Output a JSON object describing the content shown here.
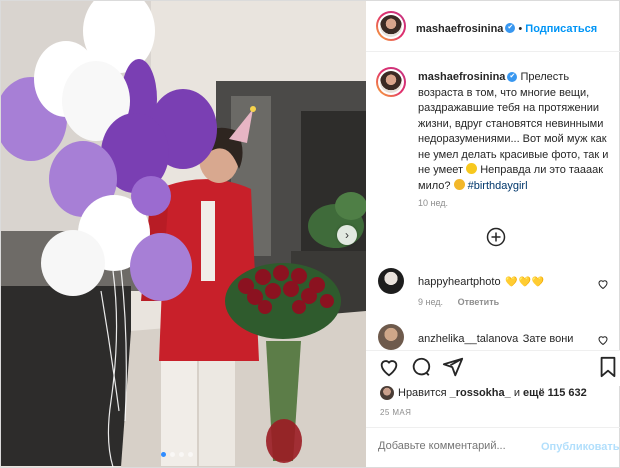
{
  "header": {
    "username": "mashaefrosinina",
    "verified_icon": "✔",
    "separator": "•",
    "follow_label": "Подписаться"
  },
  "caption": {
    "username": "mashaefrosinina",
    "verified_icon": "✔",
    "text": "Прелесть возраста в том, что многие вещи, раздражавшие тебя на протяжении жизни, вдруг становятся невинными недоразумениями... Вот мой муж как не умел делать красивые фото, так и не умеет",
    "text2": "Неправда ли это таааак мило?",
    "hashtag": "#birthdaygirl",
    "time_ago": "10 нед."
  },
  "load_more_icon": "plus-circle",
  "comments": [
    {
      "username": "happyheartphoto",
      "text": "",
      "emoji": "💛💛💛",
      "time": "9 нед.",
      "reply": "Ответить"
    },
    {
      "username": "anzhelika__talanova",
      "text": "Зате вони"
    }
  ],
  "likes": {
    "prefix": "Нравится",
    "user": "_rossokha_",
    "middle": "и",
    "count_text": "ещё 115 632"
  },
  "date": "25 МАЯ",
  "add_comment": {
    "placeholder": "Добавьте комментарий...",
    "publish": "Опубликовать"
  },
  "colors": {
    "accent": "#0095f6",
    "verified": "#3897f0",
    "publish_disabled": "#b2dffc",
    "robe": "#c8202a",
    "balloon_purple": "#7a3fb3",
    "balloon_lilac": "#a77fd6"
  }
}
